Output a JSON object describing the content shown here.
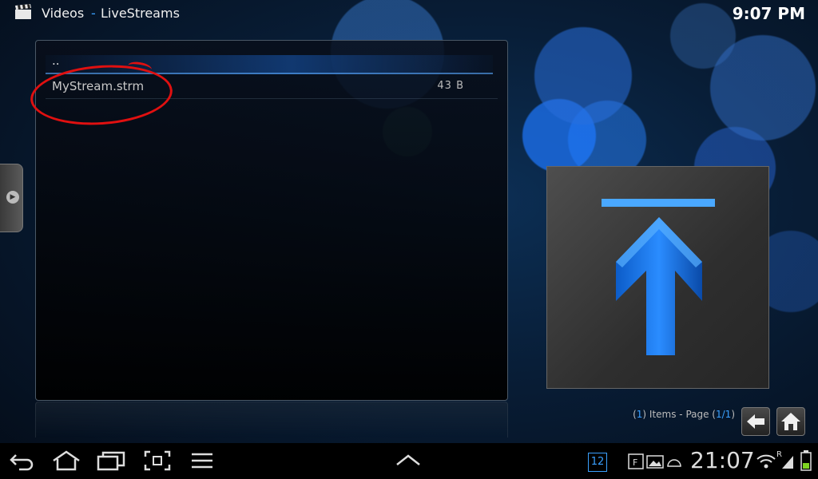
{
  "header": {
    "title": "Videos",
    "separator": "-",
    "subtitle": "LiveStreams",
    "clock": "9:07 PM"
  },
  "file_list": {
    "parent_item": "..",
    "items": [
      {
        "name": "MyStream.strm",
        "size": "43 B"
      }
    ]
  },
  "footer": {
    "items_prefix": "(",
    "items_count": "1",
    "items_mid": ") Items - Page (",
    "page": "1/1",
    "items_suffix": ")"
  },
  "system_bar": {
    "notification_count": "12",
    "time": "21:07",
    "roaming": "R"
  },
  "colors": {
    "accent": "#3aa0ff",
    "annotation": "#e01010"
  },
  "icons": {
    "title": "clapperboard-icon",
    "thumbnail": "up-arrow-icon",
    "back": "back-arrow-icon",
    "home": "home-icon"
  }
}
